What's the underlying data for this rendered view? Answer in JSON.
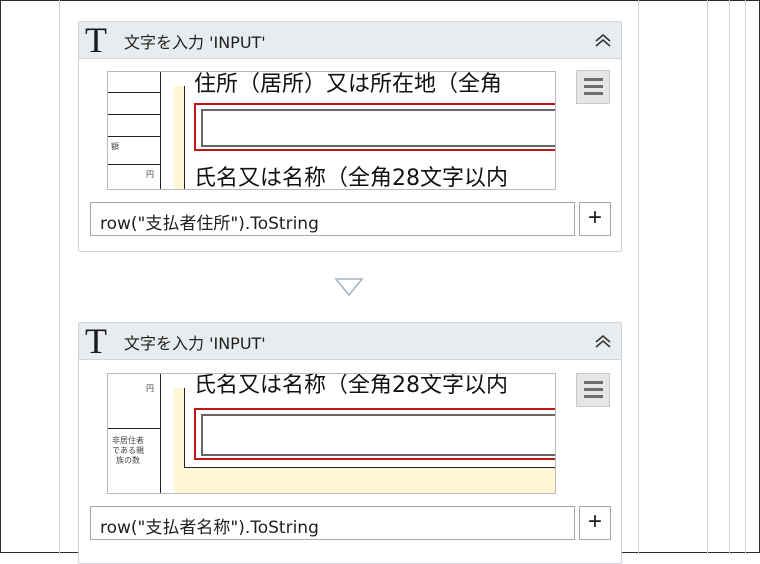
{
  "activities": [
    {
      "title": "文字を入力 'INPUT'",
      "icon": "T",
      "preview": {
        "top_text": "住所（居所）又は所在地（全角",
        "bottom_text": "氏名又は名称（全角28文字以内",
        "left_small_1": "額",
        "left_small_2": "円"
      },
      "expression": "row(\"支払者住所\").ToString",
      "plus_label": "+"
    },
    {
      "title": "文字を入力 'INPUT'",
      "icon": "T",
      "preview": {
        "top_text": "氏名又は名称（全角28文字以内",
        "left_small_1": "円",
        "left_small_2": "非居住者である親族の数"
      },
      "expression": "row(\"支払者名称\").ToString",
      "plus_label": "+"
    }
  ],
  "colors": {
    "header_bg": "#e9ecef",
    "border": "#cfd3d8",
    "highlight_red": "#c0161a",
    "highlight_yellow": "#fff6d5",
    "flow_arrow": "#a7b4be"
  },
  "icons": [
    "text-type-icon",
    "collapse-chevron-icon",
    "hamburger-menu-icon",
    "plus-icon",
    "flow-arrow-down-icon"
  ]
}
